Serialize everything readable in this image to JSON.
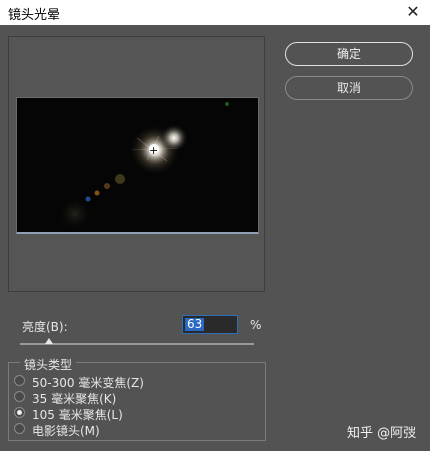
{
  "window": {
    "title": "镜头光晕",
    "close_glyph": "✕"
  },
  "buttons": {
    "ok": "确定",
    "cancel": "取消"
  },
  "brightness": {
    "label": "亮度(B):",
    "value": "63",
    "unit": "%",
    "slider_value_percent": 63
  },
  "lens_type": {
    "title": "镜头类型",
    "options": [
      "50-300 毫米变焦(Z)",
      "35 毫米聚焦(K)",
      "105 毫米聚焦(L)",
      "电影镜头(M)"
    ],
    "selected": "105 毫米聚焦(L)"
  },
  "preview": {
    "center_marker": "+"
  },
  "watermark": "知乎 @阿弢"
}
